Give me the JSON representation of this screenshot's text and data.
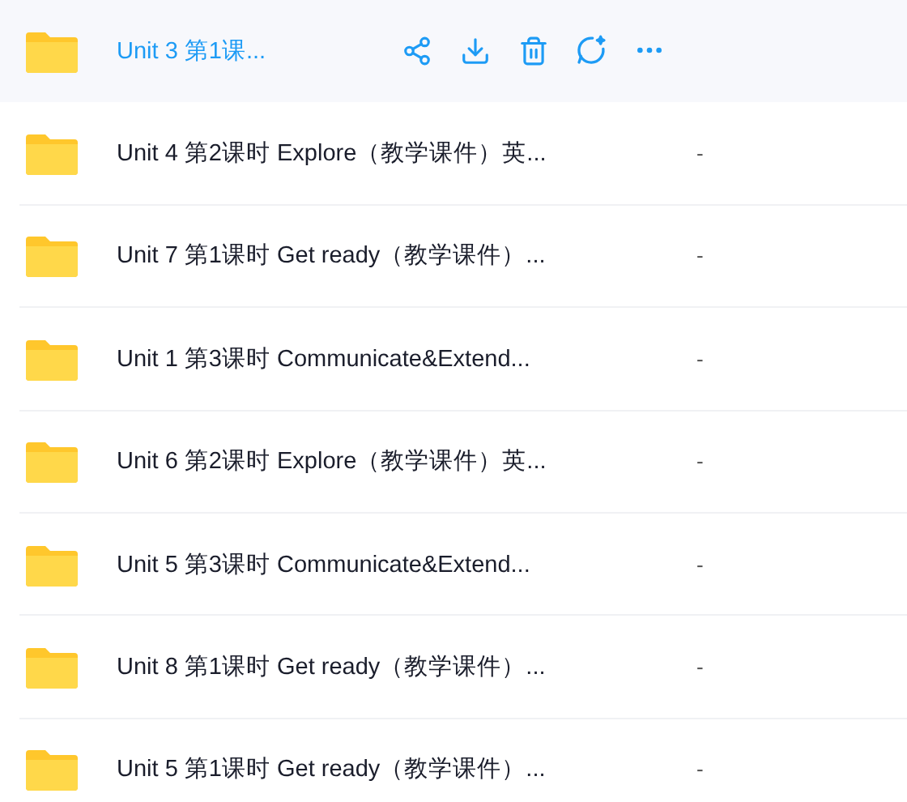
{
  "files": [
    {
      "name": "Unit 3 第1课...",
      "selected": true
    },
    {
      "name": "Unit 4 第2课时 Explore（教学课件）英...",
      "size": "-",
      "selected": false
    },
    {
      "name": "Unit 7 第1课时 Get ready（教学课件）...",
      "size": "-",
      "selected": false
    },
    {
      "name": "Unit 1 第3课时 Communicate&Extend...",
      "size": "-",
      "selected": false
    },
    {
      "name": "Unit 6 第2课时 Explore（教学课件）英...",
      "size": "-",
      "selected": false
    },
    {
      "name": "Unit 5 第3课时 Communicate&Extend...",
      "size": "-",
      "selected": false
    },
    {
      "name": "Unit 8 第1课时 Get ready（教学课件）...",
      "size": "-",
      "selected": false
    },
    {
      "name": "Unit 5 第1课时 Get ready（教学课件）...",
      "size": "-",
      "selected": false
    }
  ]
}
